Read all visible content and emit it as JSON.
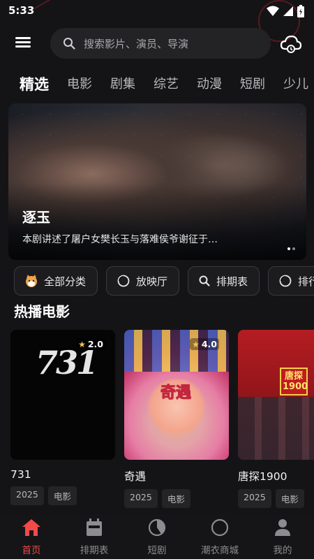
{
  "status_bar": {
    "time": "5:33"
  },
  "search": {
    "placeholder": "搜索影片、演员、导演"
  },
  "tabs": [
    {
      "label": "精选",
      "active": true
    },
    {
      "label": "电影"
    },
    {
      "label": "剧集"
    },
    {
      "label": "综艺"
    },
    {
      "label": "动漫"
    },
    {
      "label": "短剧"
    },
    {
      "label": "少儿"
    }
  ],
  "banner": {
    "title": "逐玉",
    "description": "本剧讲述了屠户女樊长玉与落难侯爷谢征于…",
    "page_count": 2,
    "current_page": 1
  },
  "quick_links": [
    {
      "label": "全部分类",
      "icon": "category-mascot-icon"
    },
    {
      "label": "放映厅",
      "icon": "screening-hall-icon"
    },
    {
      "label": "排期表",
      "icon": "search-icon"
    },
    {
      "label": "排行",
      "icon": "ranking-icon"
    }
  ],
  "section": {
    "title": "热播电影"
  },
  "movies": [
    {
      "title": "731",
      "rating": "2.0",
      "year": "2025",
      "type": "电影",
      "poster_text": "731"
    },
    {
      "title": "奇遇",
      "rating": "4.0",
      "year": "2025",
      "type": "电影",
      "poster_text": "奇遇"
    },
    {
      "title": "唐探1900",
      "rating": "",
      "year": "2025",
      "type": "电影",
      "poster_text": "唐探1900"
    }
  ],
  "bottom_nav": [
    {
      "label": "首页",
      "icon": "home-icon",
      "active": true
    },
    {
      "label": "排期表",
      "icon": "calendar-icon"
    },
    {
      "label": "短剧",
      "icon": "pie-chart-icon"
    },
    {
      "label": "潮衣商城",
      "icon": "circle-icon"
    },
    {
      "label": "我的",
      "icon": "user-icon"
    }
  ],
  "colors": {
    "accent": "#f04a4a",
    "background": "#141416",
    "star": "#f3c64c"
  }
}
